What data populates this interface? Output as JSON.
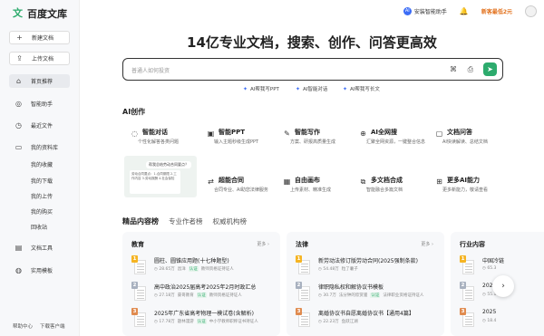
{
  "brand": {
    "logo_mark": "文",
    "name": "百度文库"
  },
  "sidebar": {
    "buttons": [
      {
        "icon": "+",
        "label": "新建文档"
      },
      {
        "icon": "⇪",
        "label": "上传文档"
      }
    ],
    "items": [
      {
        "icon": "⌂",
        "label": "首页推荐"
      },
      {
        "icon": "◎",
        "label": "智能助手"
      },
      {
        "icon": "◷",
        "label": "最近文件"
      },
      {
        "icon": "▭",
        "label": "我的资料库"
      }
    ],
    "sub_items": [
      "我的收藏",
      "我的下载",
      "我的上传",
      "我的购买",
      "回收站"
    ],
    "tools": [
      {
        "icon": "▤",
        "label": "文档工具"
      },
      {
        "icon": "◍",
        "label": "实用模板"
      }
    ],
    "footer": [
      "帮助中心",
      "下载客户端"
    ]
  },
  "topbar": {
    "assist_badge": "AI",
    "assist_label": "安装智能助手",
    "bell_icon": "🔔",
    "promo": "新客最低2元"
  },
  "hero": {
    "title": "14亿专业文档，搜索、创作、问答更高效",
    "search_placeholder": "普通人如何投资",
    "send_icon": "➤",
    "quick_actions": [
      {
        "spark": "✦",
        "label": "AI帮我写PPT"
      },
      {
        "spark": "✦",
        "label": "AI智能对话"
      },
      {
        "spark": "✦",
        "label": "AI帮我写长文"
      }
    ]
  },
  "ai_section": {
    "title": "AI创作",
    "cards": [
      {
        "icon": "◌",
        "name": "智能对话",
        "desc": "个性化解答各类问题"
      },
      {
        "icon": "▣",
        "name": "智能PPT",
        "desc": "输入主题秒级生成PPT"
      },
      {
        "icon": "✎",
        "name": "智能写作",
        "desc": "方案、研报高质量生成"
      },
      {
        "icon": "⊕",
        "name": "AI全网搜",
        "desc": "汇聚全网资源，一键整合信息"
      },
      {
        "icon": "▢",
        "name": "文档问答",
        "desc": "AI快读解读、总结文档"
      },
      {
        "icon": "⇄",
        "name": "超能合同",
        "desc": "合同专业、AI助您法律服务"
      },
      {
        "icon": "▦",
        "name": "自由画布",
        "desc": "上传素材、精准生成"
      },
      {
        "icon": "⧉",
        "name": "多文档合成",
        "desc": "智能融合多篇文档"
      },
      {
        "icon": "⊞",
        "name": "更多AI能力",
        "desc": "更多新能力，敬请查看"
      }
    ],
    "preview_bubble": "帮我总结劳动合同要点？",
    "preview_doc": "劳动合同要点：1.合同期限 2.工作内容 3.劳动报酬 4.社会保险"
  },
  "tabs": [
    {
      "label": "精品内容榜",
      "active": true
    },
    {
      "label": "专业作者榜",
      "active": false
    },
    {
      "label": "权威机构榜",
      "active": false
    }
  ],
  "columns": [
    {
      "title": "教育",
      "more": "更多 ›",
      "docs": [
        {
          "rank": "1",
          "title": "圆柱、圆锥应用题(十七种题型)",
          "stats": "◷ 28.65万",
          "author": "昌洋",
          "tag": "认证",
          "org": "教师资格证持证人"
        },
        {
          "rank": "2",
          "title": "高中政治2025届高考2025年2月时政汇总",
          "stats": "◷ 27.18万",
          "author": "豪哥教育",
          "tag": "认证",
          "org": "教师资格证持证人"
        },
        {
          "rank": "3",
          "title": "2025年广东省高考物理一模试卷(含解析)",
          "stats": "◷ 17.78万",
          "author": "题林漫游",
          "tag": "认证",
          "org": "中小学教师职称证书持证人"
        }
      ]
    },
    {
      "title": "法律",
      "more": "更多 ›",
      "docs": [
        {
          "rank": "1",
          "title": "新劳动法修订版劳动合同(2025强制条款)",
          "stats": "◷ 54.48万",
          "author": "粒了薯子",
          "tag": "",
          "org": ""
        },
        {
          "rank": "2",
          "title": "律职隐私权和解协议书模板",
          "stats": "◷ 30.7万",
          "author": "法分钟的欣赏骚",
          "tag": "认证",
          "org": "法律职业资格证持证人"
        },
        {
          "rank": "3",
          "title": "离婚协议书自愿离婚协议书【通用4篇】",
          "stats": "◷ 22.23万",
          "author": "鱼跃江湖",
          "tag": "",
          "org": ""
        }
      ]
    },
    {
      "title": "行业内容",
      "more": "",
      "docs": [
        {
          "rank": "1",
          "title": "中国冷链",
          "stats": "◷ 65.3",
          "author": "",
          "tag": "",
          "org": ""
        },
        {
          "rank": "2",
          "title": "2025",
          "stats": "◷ 55.1",
          "author": "",
          "tag": "",
          "org": ""
        },
        {
          "rank": "3",
          "title": "2025",
          "stats": "◷ 18.4",
          "author": "",
          "tag": "",
          "org": ""
        }
      ]
    }
  ],
  "next_icon": "›",
  "colors": {
    "brand_green": "#2dab6d",
    "accent_blue": "#3b6cf6",
    "promo_orange": "#e2711d",
    "rank1": "#f5b423",
    "rank2": "#a8b1bf",
    "rank3": "#e08b4f"
  }
}
